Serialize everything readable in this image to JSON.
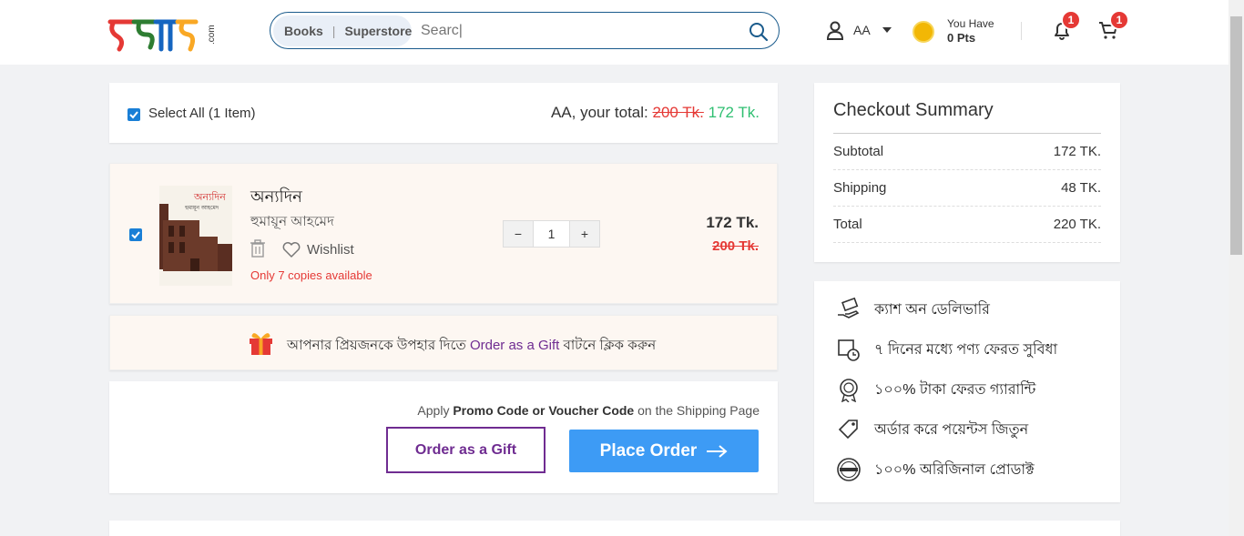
{
  "header": {
    "logo_text": "রকমারি.com",
    "search": {
      "segment_books": "Books",
      "segment_superstore": "Superstore",
      "placeholder": "Searc|"
    },
    "user_label": "AA",
    "points": {
      "line1": "You Have",
      "line2": "0 Pts"
    },
    "notification_count": "1",
    "cart_count": "1"
  },
  "select_all": {
    "label": "Select All (1 Item)",
    "total_prefix": "AA, your total:",
    "original_total": "200 Tk.",
    "discounted_total": "172 Tk."
  },
  "cart_item": {
    "title": "অন্যদিন",
    "author": "হুমায়ূন আহমেদ",
    "wishlist_label": "Wishlist",
    "availability": "Only 7 copies available",
    "quantity": "1",
    "qty_minus": "−",
    "qty_plus": "+",
    "price": "172 Tk.",
    "original_price": "200 Tk.",
    "cover_title": "অন্যদিন",
    "cover_author": "হুমায়ূন আহমেদ"
  },
  "gift_banner": {
    "text_before": "আপনার প্রিয়জনকে উপহার দিতে",
    "link": "Order as a Gift",
    "text_after": "বাটনে ক্লিক করুন"
  },
  "promo": {
    "prefix": "Apply",
    "bold": "Promo Code or Voucher Code",
    "suffix": "on the Shipping Page",
    "gift_button": "Order as a Gift",
    "order_button": "Place Order"
  },
  "summary": {
    "title": "Checkout Summary",
    "rows": [
      {
        "label": "Subtotal",
        "value": "172 TK."
      },
      {
        "label": "Shipping",
        "value": "48 TK."
      },
      {
        "label": "Total",
        "value": "220 TK."
      }
    ]
  },
  "benefits": [
    {
      "icon": "cash-hand-icon",
      "text": "ক্যাশ অন ডেলিভারি"
    },
    {
      "icon": "return-box-icon",
      "text": "৭ দিনের মধ্যে পণ্য ফেরত সুবিধা"
    },
    {
      "icon": "money-back-icon",
      "text": "১০০% টাকা ফেরত গ্যারান্টি"
    },
    {
      "icon": "points-tag-icon",
      "text": "অর্ডার করে পয়েন্টস জিতুন"
    },
    {
      "icon": "original-seal-icon",
      "text": "১০০% অরিজিনাল প্রোডাক্ট"
    }
  ],
  "colors": {
    "primary_blue": "#3d9bf5",
    "gift_purple": "#6f2c91",
    "price_red": "#e53935",
    "price_green": "#2fbf71",
    "badge_red": "#e53935"
  }
}
